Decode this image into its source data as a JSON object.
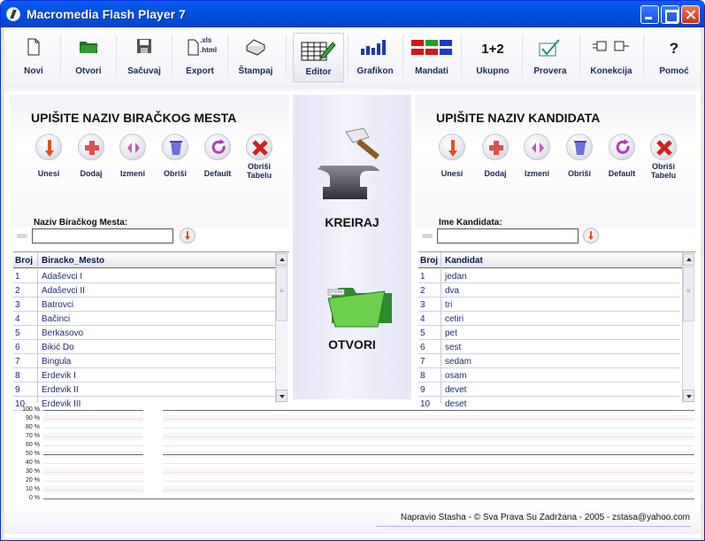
{
  "window": {
    "title": "Macromedia Flash Player 7"
  },
  "toolbar": {
    "items": [
      {
        "label": "Novi",
        "icon": "new-document-icon"
      },
      {
        "label": "Otvori",
        "icon": "open-folder-icon"
      },
      {
        "label": "Sačuvaj",
        "icon": "save-disk-icon"
      },
      {
        "label": "Export",
        "icon": "export-icon",
        "sub1": ".xls",
        "sub2": ".html"
      },
      {
        "label": "Štampaj",
        "icon": "print-icon"
      },
      {
        "label": "Editor",
        "icon": "table-editor-icon"
      },
      {
        "label": "Grafikon",
        "icon": "bar-chart-icon"
      },
      {
        "label": "Mandati",
        "icon": "mandates-icon"
      },
      {
        "label": "Ukupno",
        "icon": "sum-icon",
        "glyph": "1+2"
      },
      {
        "label": "Provera",
        "icon": "check-icon"
      },
      {
        "label": "Konekcija",
        "icon": "connection-icon"
      },
      {
        "label": "Pomoć",
        "icon": "help-icon",
        "glyph": "?"
      }
    ]
  },
  "left": {
    "title": "UPIŠITE NAZIV BIRAČKOG MESTA",
    "actions": [
      "Unesi",
      "Dodaj",
      "Izmeni",
      "Obriši",
      "Default",
      "Obriši Tabelu"
    ],
    "field_label": "Naziv Biračkog Mesta:",
    "field_value": "",
    "columns": [
      "Broj",
      "Biracko_Mesto"
    ],
    "rows": [
      [
        "1",
        "Adaševci I"
      ],
      [
        "2",
        "Adaševci II"
      ],
      [
        "3",
        "Batrovci"
      ],
      [
        "4",
        "Bačinci"
      ],
      [
        "5",
        "Berkasovo"
      ],
      [
        "6",
        "Bikić Do"
      ],
      [
        "7",
        "Bingula"
      ],
      [
        "8",
        "Erdevik I"
      ],
      [
        "9",
        "Erdevik II"
      ],
      [
        "10",
        "Erdevik III"
      ]
    ]
  },
  "right": {
    "title": "UPIŠITE NAZIV KANDIDATA",
    "actions": [
      "Unesi",
      "Dodaj",
      "Izmeni",
      "Obriši",
      "Default",
      "Obriši Tabelu"
    ],
    "field_label": "Ime Kandidata:",
    "field_value": "",
    "columns": [
      "Broj",
      "Kandidat"
    ],
    "rows": [
      [
        "1",
        "jedan"
      ],
      [
        "2",
        "dva"
      ],
      [
        "3",
        "tri"
      ],
      [
        "4",
        "cetiri"
      ],
      [
        "5",
        "pet"
      ],
      [
        "6",
        "sest"
      ],
      [
        "7",
        "sedam"
      ],
      [
        "8",
        "osam"
      ],
      [
        "9",
        "devet"
      ],
      [
        "10",
        "deset"
      ]
    ]
  },
  "center": {
    "create_label": "KREIRAJ",
    "open_label": "OTVORI",
    "folder_tag": "OTVORI"
  },
  "chart_data": {
    "type": "bar",
    "categories": [],
    "series": [],
    "ylim": [
      0,
      100
    ],
    "yticks": [
      "100 %",
      "90 %",
      "80 %",
      "70 %",
      "60 %",
      "50 %",
      "40 %",
      "30 %",
      "20 %",
      "10 %",
      "0 %"
    ]
  },
  "footer": {
    "text": "Napravio Stasha - © Sva Prava Su Zadržana - 2005 - zstasa@yahoo.com"
  }
}
